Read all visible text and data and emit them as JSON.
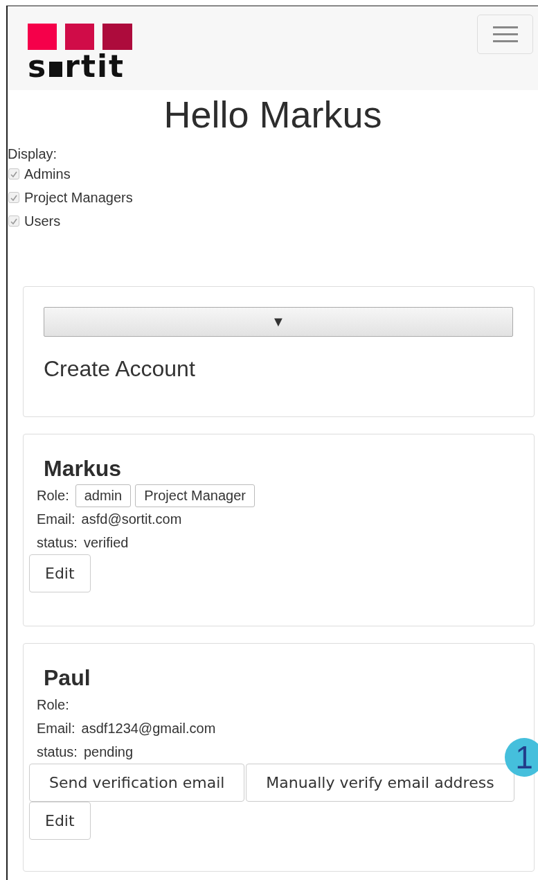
{
  "navbar": {
    "logo": {
      "text_start": "s",
      "text_end": "rtit"
    }
  },
  "heading": "Hello Markus",
  "display": {
    "label": "Display:",
    "options": [
      {
        "label": "Admins",
        "checked": true
      },
      {
        "label": "Project Managers",
        "checked": true
      },
      {
        "label": "Users",
        "checked": true
      }
    ]
  },
  "create_panel": {
    "toggle": "▼",
    "title": "Create Account"
  },
  "users": [
    {
      "name": "Markus",
      "role_label": "Role:",
      "roles": [
        "admin",
        "Project Manager"
      ],
      "email_label": "Email:",
      "email": "asfd@sortit.com",
      "status_label": "status:",
      "status": "verified",
      "edit": "Edit"
    },
    {
      "name": "Paul",
      "role_label": "Role:",
      "email_label": "Email:",
      "email": "asdf1234@gmail.com",
      "status_label": "status:",
      "status": "pending",
      "actions": [
        "Send verification email",
        "Manually verify email address"
      ],
      "edit": "Edit",
      "callout": "1"
    }
  ]
}
